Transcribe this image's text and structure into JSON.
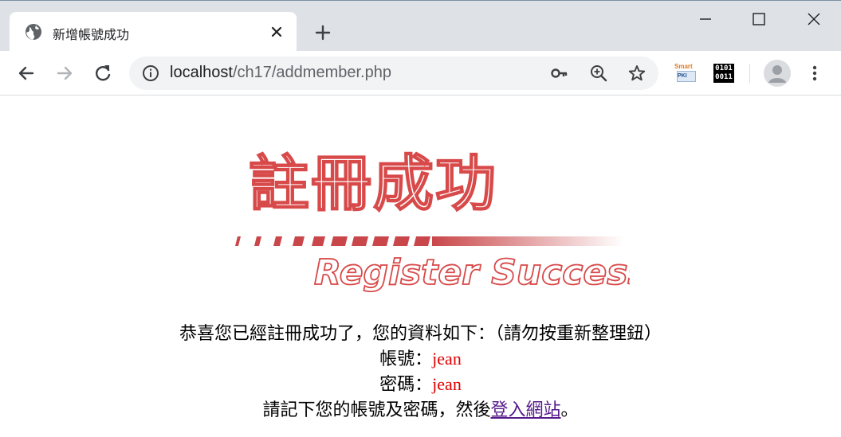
{
  "browser": {
    "tab_title": "新增帳號成功",
    "url_host": "localhost",
    "url_path": "/ch17/addmember.php",
    "extensions": {
      "smart_label": "Smart",
      "smart_sub": "PKI",
      "binary_line1": "0101",
      "binary_line2": "0011"
    }
  },
  "page": {
    "banner": {
      "title": "註冊成功",
      "subtitle": "Register Success",
      "color": "#d84a4a"
    },
    "intro": "恭喜您已經註冊成功了，您的資料如下：（請勿按重新整理鈕）",
    "account_label": "帳號：",
    "account_value": "jean",
    "password_label": "密碼：",
    "password_value": "jean",
    "closing_prefix": "請記下您的帳號及密碼，然後",
    "login_link": "登入網站",
    "closing_suffix": "。"
  },
  "colors": {
    "tabbar": "#dee1e6",
    "value_red": "#e00000",
    "visited_link": "#551a8b"
  }
}
